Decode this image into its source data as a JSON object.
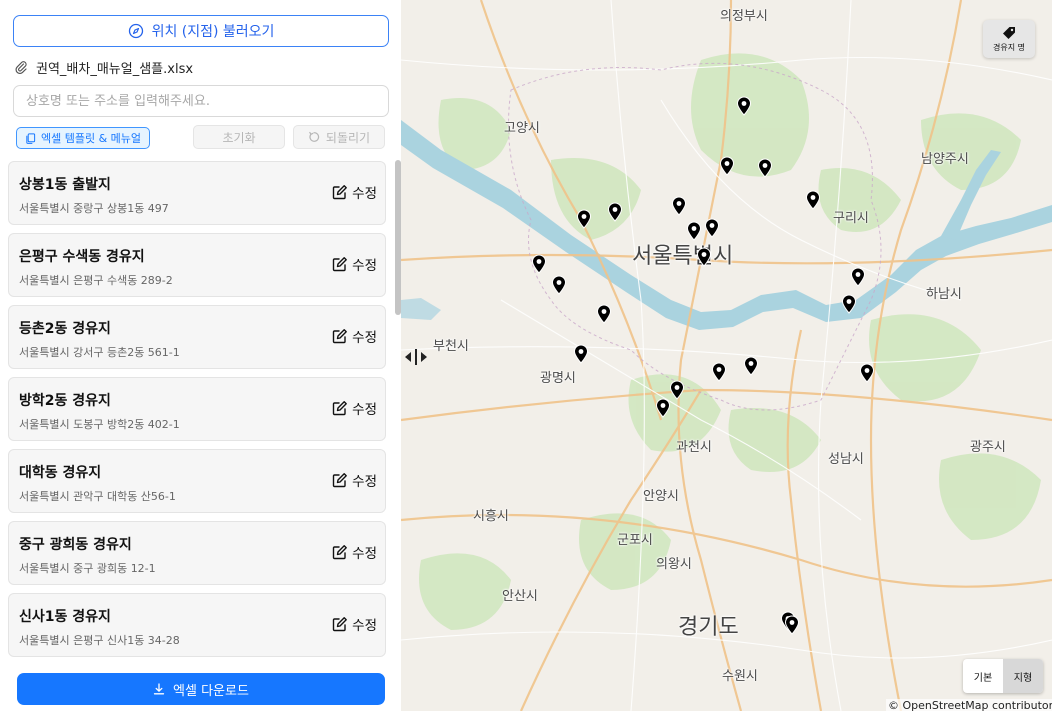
{
  "panel": {
    "load_button_label": "위치 (지점) 불러오기",
    "file_name": "권역_배차_매뉴얼_샘플.xlsx",
    "search_placeholder": "상호명 또는 주소를 입력해주세요.",
    "template_button_label": "엑셀 템플릿 & 메뉴얼",
    "reset_button_label": "초기화",
    "undo_button_label": "되돌리기",
    "edit_label": "수정",
    "locations": [
      {
        "name": "상봉1동 출발지",
        "address": "서울특별시 중랑구 상봉1동 497"
      },
      {
        "name": "은평구 수색동 경유지",
        "address": "서울특별시 은평구 수색동 289-2"
      },
      {
        "name": "등촌2동 경유지",
        "address": "서울특별시 강서구 등촌2동 561-1"
      },
      {
        "name": "방학2동 경유지",
        "address": "서울특별시 도봉구 방학2동 402-1"
      },
      {
        "name": "대학동 경유지",
        "address": "서울특별시 관악구 대학동 산56-1"
      },
      {
        "name": "중구 광희동 경유지",
        "address": "서울특별시 중구 광희동 12-1"
      },
      {
        "name": "신사1동 경유지",
        "address": "서울특별시 은평구 신사1동 34-28"
      }
    ],
    "download_button_label": "엑셀 다운로드"
  },
  "map": {
    "layer_button_label": "경유지 명",
    "basemap_options": [
      "기본",
      "지형"
    ],
    "basemap_selected": "지형",
    "attribution": "© OpenStreetMap contributors",
    "place_labels": [
      {
        "text": "의정부시"
      },
      {
        "text": "고양시"
      },
      {
        "text": "남양주시"
      },
      {
        "text": "구리시"
      },
      {
        "text": "서울특별시",
        "big": true
      },
      {
        "text": "하남시"
      },
      {
        "text": "부천시"
      },
      {
        "text": "광명시"
      },
      {
        "text": "과천시"
      },
      {
        "text": "성남시"
      },
      {
        "text": "광주시"
      },
      {
        "text": "안양시"
      },
      {
        "text": "시흥시"
      },
      {
        "text": "군포시"
      },
      {
        "text": "의왕시"
      },
      {
        "text": "안산시"
      },
      {
        "text": "경기도",
        "big": true
      },
      {
        "text": "수원시"
      }
    ]
  },
  "colors": {
    "primary": "#1677ff",
    "water": "#aad3df",
    "park": "#c8e3b4",
    "land": "#f2efe9"
  }
}
